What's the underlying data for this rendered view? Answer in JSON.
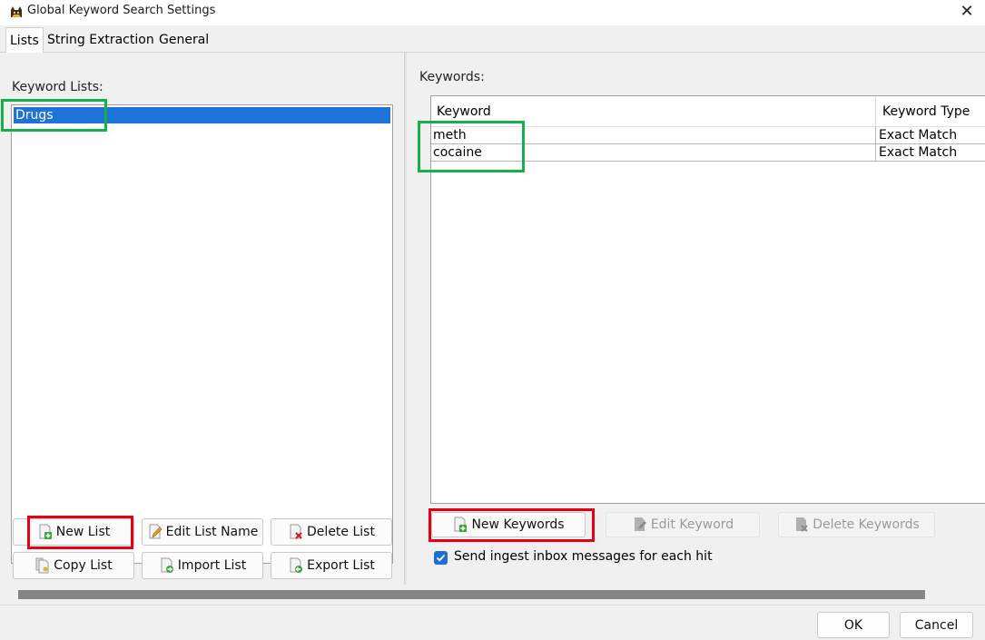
{
  "window": {
    "title": "Global Keyword Search Settings",
    "close_glyph": "✕"
  },
  "tabs": [
    {
      "label": "Lists",
      "active": true
    },
    {
      "label": "String Extraction",
      "active": false
    },
    {
      "label": "General",
      "active": false
    }
  ],
  "left": {
    "section_label": "Keyword Lists:",
    "lists": [
      {
        "name": "Drugs",
        "selected": true
      }
    ],
    "buttons": {
      "new_list": "New List",
      "edit_list_name": "Edit List Name",
      "delete_list": "Delete List",
      "copy_list": "Copy List",
      "import_list": "Import List",
      "export_list": "Export List"
    }
  },
  "right": {
    "section_label": "Keywords:",
    "columns": [
      "Keyword",
      "Keyword Type"
    ],
    "rows": [
      {
        "keyword": "meth",
        "type": "Exact Match"
      },
      {
        "keyword": "cocaine",
        "type": "Exact Match"
      }
    ],
    "buttons": {
      "new_keywords": "New Keywords",
      "edit_keyword": "Edit Keyword",
      "delete_keywords": "Delete Keywords"
    },
    "send_ingest_label": "Send ingest inbox messages for each hit",
    "send_ingest_checked": true
  },
  "footer": {
    "ok": "OK",
    "cancel": "Cancel"
  },
  "colors": {
    "selection": "#1e73d9",
    "annotation_green": "#16b04a",
    "annotation_red": "#e60012"
  },
  "icons": {
    "app": "autopsy-dog-icon",
    "new": "page-plus-icon",
    "edit": "page-pencil-icon",
    "delete": "page-x-icon",
    "copy": "page-copy-icon",
    "import": "page-import-icon",
    "export": "page-export-icon"
  }
}
